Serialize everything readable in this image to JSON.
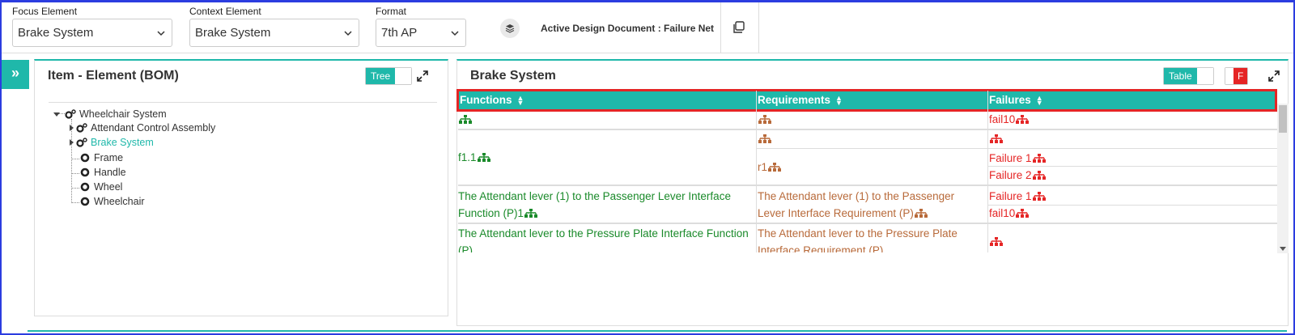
{
  "toolbar": {
    "focus_label": "Focus Element",
    "focus_value": "Brake System",
    "context_label": "Context Element",
    "context_value": "Brake System",
    "format_label": "Format",
    "format_value": "7th AP",
    "active_document": "Active Design Document : Failure Net"
  },
  "left_panel": {
    "title": "Item - Element (BOM)",
    "toggle_label": "Tree",
    "tree": [
      {
        "label": "Wheelchair System",
        "selected": false
      },
      {
        "label": "Attendant Control Assembly",
        "selected": false
      },
      {
        "label": "Brake System",
        "selected": true
      },
      {
        "label": "Frame",
        "selected": false
      },
      {
        "label": "Handle",
        "selected": false
      },
      {
        "label": "Wheel",
        "selected": false
      },
      {
        "label": "Wheelchair",
        "selected": false
      }
    ]
  },
  "right_panel": {
    "title": "Brake System",
    "toggle_label": "Table",
    "filter_label": "F",
    "columns": [
      "Functions",
      "Requirements",
      "Failures"
    ],
    "rows": {
      "r1_fail": "fail10",
      "r2_func": "f1.1",
      "r2_req": "r1",
      "r2_fail1": "Failure 1",
      "r2_fail2": "Failure 2",
      "r3_func": "The Attendant lever (1) to the Passenger Lever Interface Function (P)1",
      "r3_req": "The Attendant lever (1) to the Passenger Lever Interface Requirement (P)",
      "r3_fail1": "Failure 1",
      "r3_fail2": "fail10",
      "r4_func": "The Attendant lever to the Pressure Plate Interface Function (P)",
      "r4_req": "The Attendant lever to the Pressure Plate Interface Requirement (P)"
    }
  },
  "colors": {
    "accent": "#1fb8aa",
    "function": "#1a8a2a",
    "requirement": "#b86a3a",
    "failure": "#e52525",
    "highlight": "#e52525"
  },
  "icons": [
    "chevron-down-icon",
    "layers-icon",
    "copy-icon",
    "double-chevron-right-icon",
    "expand-icon",
    "gear-icon",
    "hierarchy-icon",
    "sort-icon"
  ]
}
